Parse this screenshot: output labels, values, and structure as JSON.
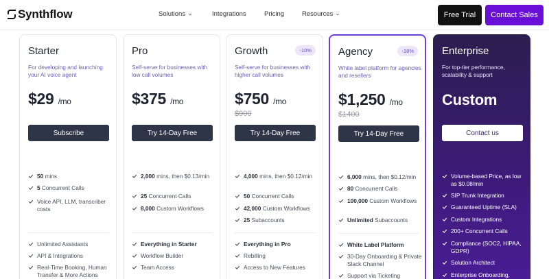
{
  "header": {
    "brand": "Synthflow",
    "nav": [
      "Solutions",
      "Integrations",
      "Pricing",
      "Resources"
    ],
    "free_trial": "Free Trial",
    "contact_sales": "Contact Sales"
  },
  "colors": {
    "accent": "#6a0fd8",
    "dark_button": "#2e3547",
    "badge_bg": "#ece6fb"
  },
  "plans": [
    {
      "name": "Starter",
      "desc": "For developing and launching your AI voice agent",
      "price": "$29",
      "per": "/mo",
      "cta": "Subscribe",
      "features": [
        "50 mins",
        "5 Concurrent Calls",
        "Voice API, LLM, transcriber costs"
      ],
      "extras": [
        "Unlimited Assistants",
        "API & Integrations",
        "Real-Time Booking, Human Transfer & More Actions"
      ]
    },
    {
      "name": "Pro",
      "desc": "Self-serve for businesses with low call volumes",
      "price": "$375",
      "per": "/mo",
      "cta": "Try 14-Day Free",
      "features": [
        "2,000 mins, then $0.13/min",
        "25 Concurrent Calls",
        "8,000 Custom Workflows"
      ],
      "extras": [
        "Everything in Starter",
        "Workflow Builder",
        "Team Access"
      ]
    },
    {
      "name": "Growth",
      "badge": "-10%",
      "desc": "Self-serve for businesses with higher call volumes",
      "price": "$750",
      "per": "/mo",
      "old_price": "$900",
      "cta": "Try 14-Day Free",
      "features": [
        "4,000 mins, then $0.12/min",
        "50 Concurrent Calls",
        "42,000 Custom Workflows",
        "25 Subaccounts"
      ],
      "extras": [
        "Everything in Pro",
        "Rebilling",
        "Access to New Features"
      ]
    },
    {
      "name": "Agency",
      "badge": "-18%",
      "desc": "White label platform for agencies and resellers",
      "price": "$1,250",
      "per": "/mo",
      "old_price": "$1400",
      "cta": "Try 14-Day Free",
      "features": [
        "6,000 mins, then $0.12/min",
        "80 Concurrent Calls",
        "100,000 Custom Workflows",
        "Unlimited Subaccounts"
      ],
      "extras": [
        "White Label Platform",
        "30-Day Onboarding & Private Slack Channel",
        "Support via Ticketing"
      ]
    },
    {
      "name": "Enterprise",
      "desc": "For top-tier performance, scalability & support",
      "price": "Custom",
      "cta": "Contact us",
      "features": [
        "Volume-based Price, as low as $0.08/min",
        "SIP Trunk Integration",
        "Guaranteed Uptime (SLA)",
        "Custom Integrations",
        "200+ Concurrent Calls",
        "Compliance (SOC2, HIPAA, GDPR)",
        "Solution Architect",
        "Enterprise Onboarding,"
      ]
    }
  ]
}
